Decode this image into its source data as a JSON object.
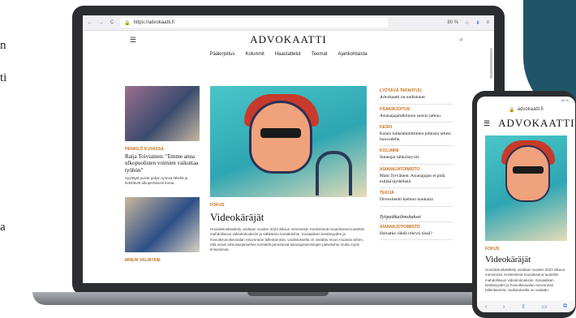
{
  "edge_text": [
    "n",
    "ti",
    "a"
  ],
  "browser": {
    "back": "←",
    "forward": "→",
    "reload": "C",
    "url": "https://advokaatti.fi",
    "zoom": "80 %"
  },
  "site": {
    "logo": "ADVOKAATTI",
    "nav": [
      "Pääkirjoitus",
      "Kolumnit",
      "Haastattelut",
      "Teemat",
      "Ajankohtaista"
    ]
  },
  "left_col": {
    "story1": {
      "kicker": "HENKILÖ KUVASSA",
      "title": "Raija Toiviainen: \"Emme anna ulkopuolisten voimien vaikuttaa työhön\"",
      "text": "Syyttäjät puivat paljon työnsä lähellä ja kehittävät alkuperäisesti kunta."
    },
    "story2": {
      "kicker": "MINUN VALINTANI"
    }
  },
  "main": {
    "kicker": "FOKUS",
    "title": "Videokäräjät",
    "text": "Hovioikeuskäsittely osaltaan vuoden 2023 alkuun mennessä. Keskeisenä muutoksena tuotettiin mahdollisuus videokokouksiin ja sähköisiin kontakteihin. Sosiaalisen kestävyyden ja hovioikeusoikeusalan neuvonnan tallentamista. Uudistuksella on vastattu muun muassa siihen, että useat oikeusasiamiehen kontaktit perustuvat asianajotoimistojen palveluihin mutta myös kriisiolanaa."
  },
  "right_col": {
    "items": [
      {
        "kicker": "LYÖTÄVÄ TAPAHTUU",
        "title": "Advokaatti on uudistunut"
      },
      {
        "kicker": "PÄÄKIRJOITUS",
        "title": "Asianajajatutkinnon suosio jatkuu"
      },
      {
        "kicker": "KESKI",
        "title": "Kaista lohkeämmittimen johtosta urkesi huovudella"
      },
      {
        "kicker": "KOLUMNI",
        "title": "Ihmeajat sähköistyvät"
      },
      {
        "kicker": "ASIANAJATOIMISTO",
        "title": "Matti Tyrväinen: Asianajajan ei pidä esittää täydellistä"
      },
      {
        "kicker": "TEKIJÄ",
        "title": "Diversiteetti kiehtoo konkaria"
      }
    ],
    "section": "Työpaikkailmoitukset",
    "section_item": {
      "kicker": "ASIANAJOTOIMISTO",
      "title": "Haluatko rähdä rekrysi tässä?"
    }
  },
  "phone": {
    "status": "50 %",
    "url": "advokaatti.fi",
    "logo": "ADVOKAATTI",
    "kicker": "FOKUS",
    "title": "Videokäräjät",
    "text": "Hovioikeuskäsittely osaltaan vuoden 2023 alkuun mennessä. Keskeisenä muutoksena tuotettiin mahdollisuus videokokouksiin. Sosiaalisen kestävyyden ja hovioikeusalan neuvonnan tallentamista. Uudistuksella on vastattu."
  }
}
